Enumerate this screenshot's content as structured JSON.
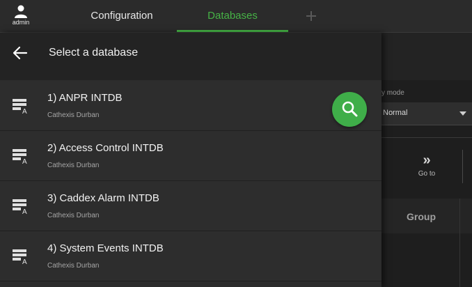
{
  "topbar": {
    "admin_label": "admin",
    "tabs": [
      {
        "label": "Configuration"
      },
      {
        "label": "Databases"
      }
    ],
    "add_tab_icon": "plus-icon",
    "accent_color": "#46b346"
  },
  "background_page": {
    "view_mode_label": "y mode",
    "view_mode_value": "Normal",
    "goto_label": "Go to",
    "goto_icon": "double-chevron-right-icon",
    "group_column_header": "Group"
  },
  "drawer": {
    "title": "Select a database",
    "back_icon": "arrow-left-icon",
    "search_icon": "search-icon",
    "search_button_color": "#3fae49",
    "items": [
      {
        "name": "1) ANPR INTDB",
        "subtitle": "Cathexis Durban",
        "icon": "database-server-icon"
      },
      {
        "name": "2) Access Control INTDB",
        "subtitle": "Cathexis Durban",
        "icon": "database-server-icon"
      },
      {
        "name": "3) Caddex Alarm INTDB",
        "subtitle": "Cathexis Durban",
        "icon": "database-server-icon"
      },
      {
        "name": "4) System Events INTDB",
        "subtitle": "Cathexis Durban",
        "icon": "database-server-icon"
      }
    ]
  }
}
